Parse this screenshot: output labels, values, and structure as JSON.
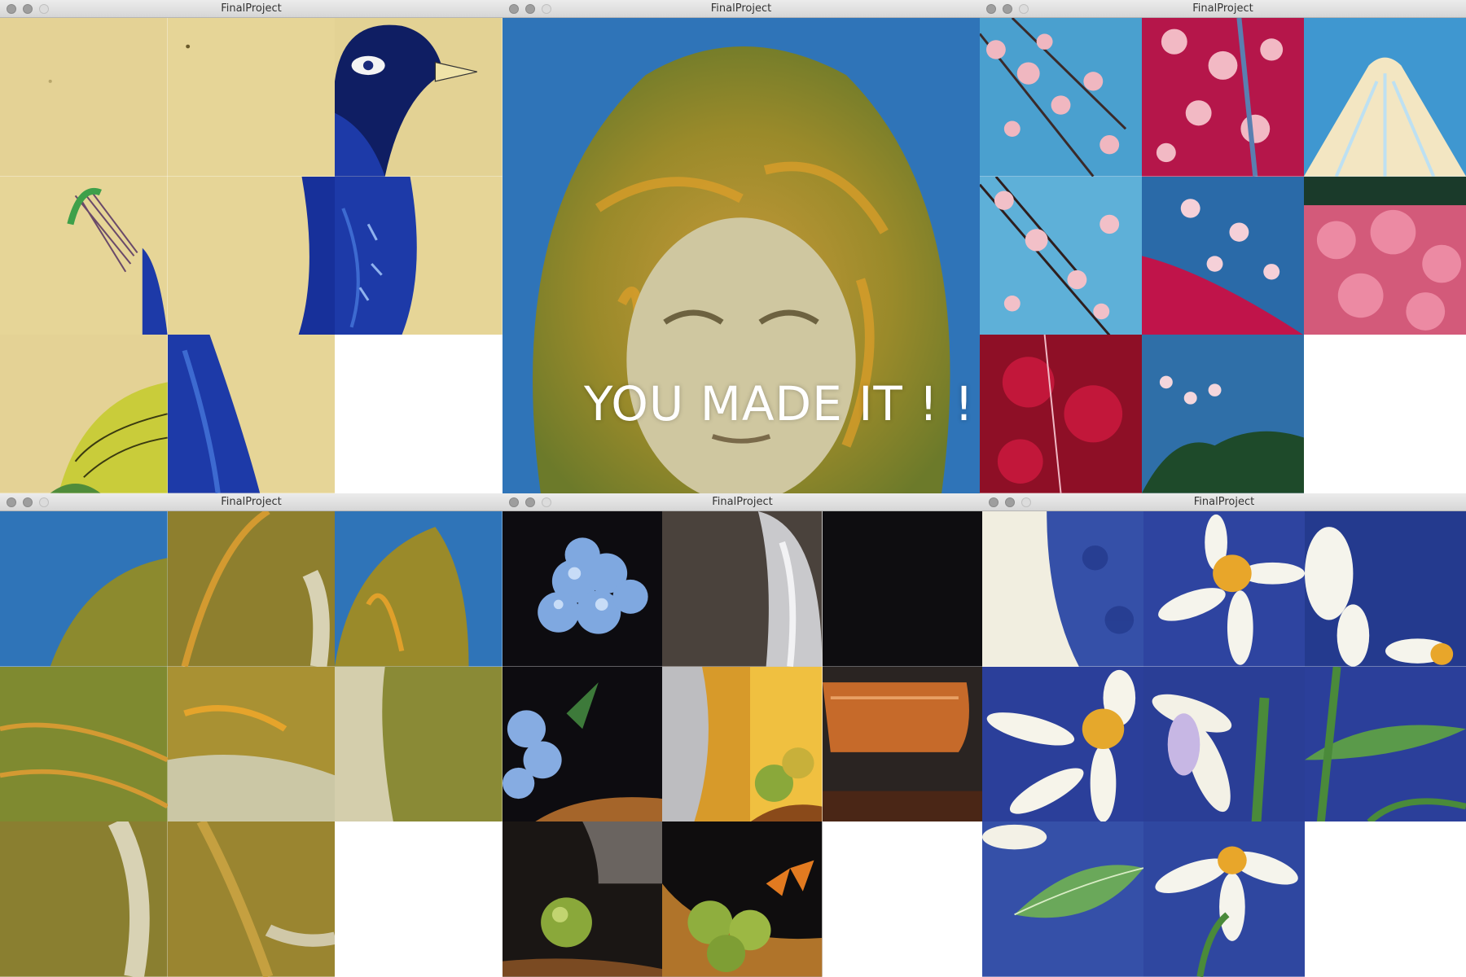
{
  "windows": [
    {
      "title": "FinalProject"
    },
    {
      "title": "FinalProject"
    },
    {
      "title": "FinalProject"
    },
    {
      "title": "FinalProject"
    },
    {
      "title": "FinalProject"
    },
    {
      "title": "FinalProject"
    }
  ],
  "solved_message": "YOU MADE IT ! !",
  "puzzles": [
    {
      "name": "peacock",
      "empty_tile": 9
    },
    {
      "name": "face",
      "solved": true
    },
    {
      "name": "cherry-blossoms",
      "empty_tile": 9
    },
    {
      "name": "face",
      "empty_tile": 9
    },
    {
      "name": "still-life",
      "empty_tile": 9
    },
    {
      "name": "daisies",
      "empty_tile": 9
    }
  ],
  "colors": {
    "parchment": "#e6d597",
    "peacock_blue": "#1d3aa8",
    "sky_blue": "#3b8fc9",
    "ochre": "#b7952a",
    "blossom_pink": "#e7a3b0",
    "crimson": "#a0122c",
    "still_life_bg": "#0d0c10",
    "daisy_blue": "#2b3f9a"
  }
}
